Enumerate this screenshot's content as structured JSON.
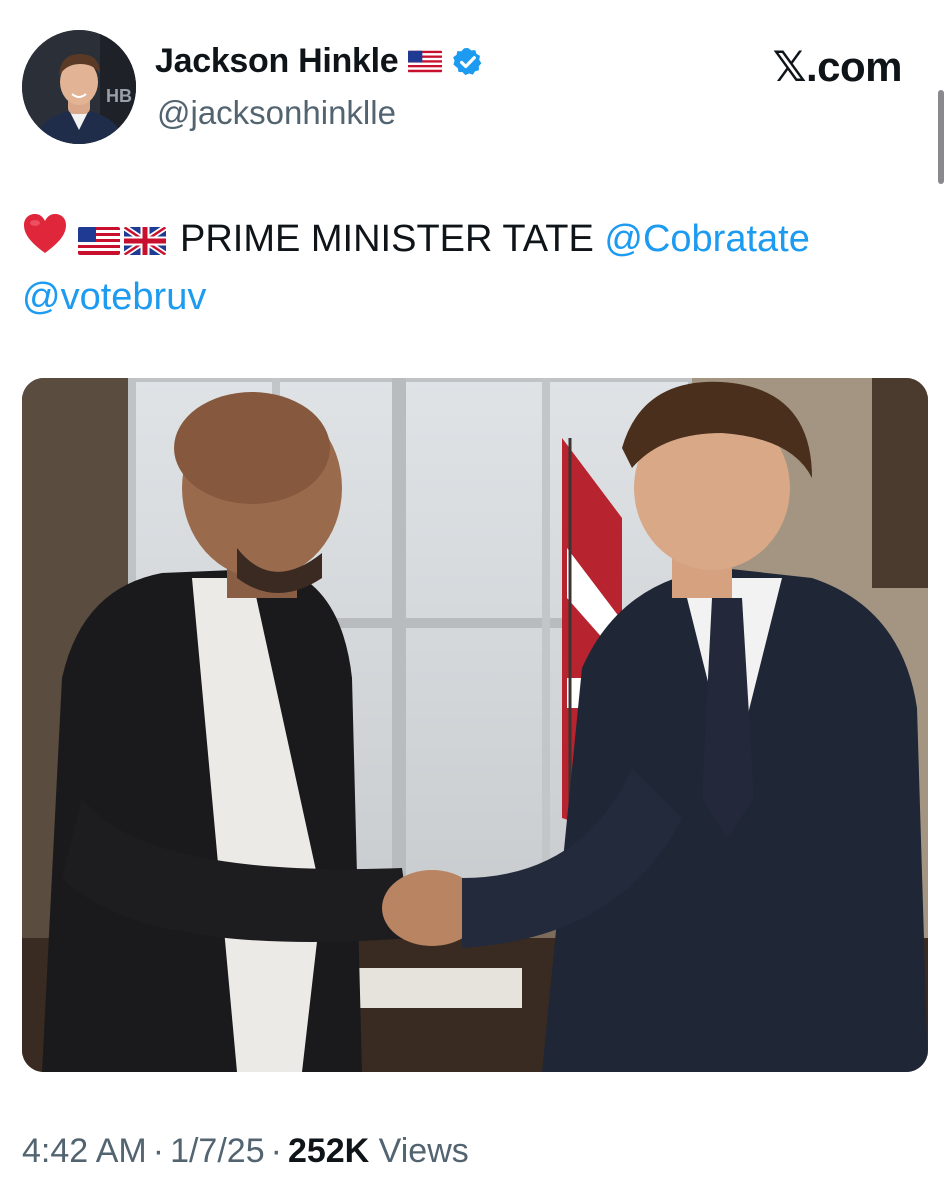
{
  "author": {
    "display_name": "Jackson Hinkle",
    "handle": "@jacksonhinklle",
    "flag_icon": "us-flag-icon",
    "verified_icon": "verified-badge-icon",
    "verified_color": "#1d9bf0"
  },
  "brand": {
    "label": "𝕏.com"
  },
  "tweet": {
    "emojis": [
      "heart-icon",
      "us-flag-icon",
      "uk-flag-icon"
    ],
    "text": "PRIME MINISTER TATE",
    "mentions": [
      "@Cobratate",
      "@votebruv"
    ],
    "mention_color": "#1d9bf0"
  },
  "meta": {
    "time": "4:42 AM",
    "separator": "·",
    "date": "1/7/25",
    "views_count": "252K",
    "views_label": "Views"
  }
}
